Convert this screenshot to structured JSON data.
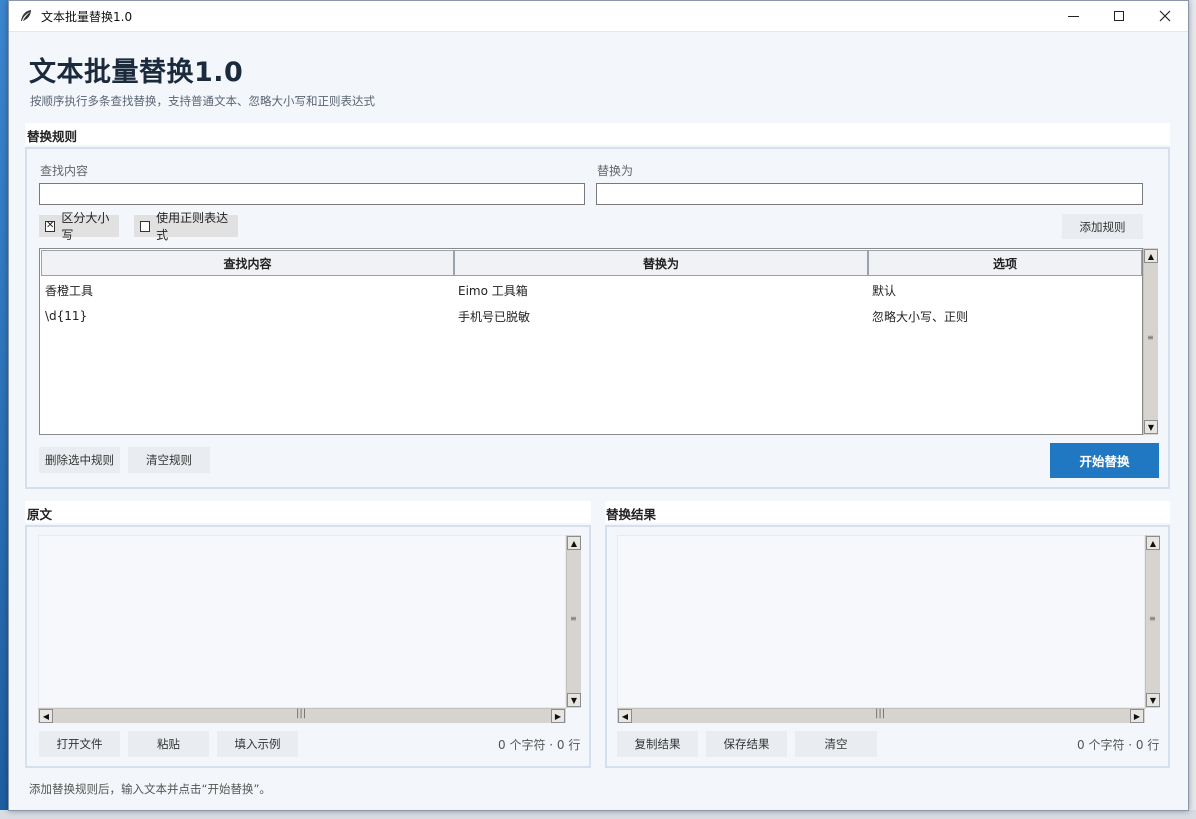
{
  "window": {
    "title": "文本批量替换1.0"
  },
  "header": {
    "title": "文本批量替换1.0",
    "subtitle": "按顺序执行多条查找替换，支持普通文本、忽略大小写和正则表达式"
  },
  "rules_panel": {
    "label": "替换规则",
    "find_label": "查找内容",
    "replace_label": "替换为",
    "find_value": "",
    "replace_value": "",
    "case_sensitive_label": "区分大小写",
    "case_sensitive_checked": true,
    "regex_label": "使用正则表达式",
    "regex_checked": false,
    "add_rule_label": "添加规则",
    "columns": [
      "查找内容",
      "替换为",
      "选项"
    ],
    "rows": [
      {
        "find": "香橙工具",
        "replace": "Eimo 工具箱",
        "options": "默认"
      },
      {
        "find": "\\d{11}",
        "replace": "手机号已脱敏",
        "options": "忽略大小写、正则"
      }
    ],
    "delete_selected_label": "删除选中规则",
    "clear_rules_label": "清空规则",
    "start_label": "开始替换"
  },
  "source_panel": {
    "label": "原文",
    "open_file_label": "打开文件",
    "paste_label": "粘贴",
    "fill_example_label": "填入示例",
    "count": "0 个字符 · 0 行"
  },
  "result_panel": {
    "label": "替换结果",
    "copy_label": "复制结果",
    "save_label": "保存结果",
    "clear_label": "清空",
    "count": "0 个字符 · 0 行"
  },
  "status": "添加替换规则后，输入文本并点击“开始替换”。",
  "icons": {
    "app": "feather-icon",
    "check": "checkmark-icon",
    "scroll_up": "arrow-up-icon",
    "scroll_down": "arrow-down-icon",
    "scroll_left": "arrow-left-icon",
    "scroll_right": "arrow-right-icon"
  },
  "colors": {
    "primary": "#1f78c1",
    "title": "#1b2a3c"
  }
}
